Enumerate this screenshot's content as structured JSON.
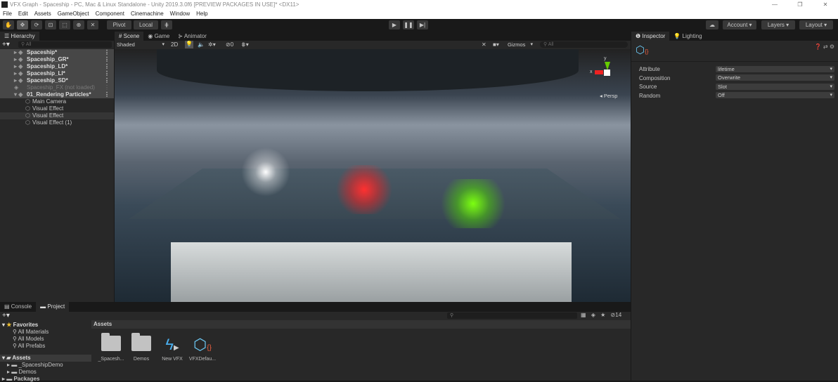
{
  "window": {
    "title": "VFX Graph - Spaceship - PC, Mac & Linux Standalone - Unity 2019.3.0f6 [PREVIEW PACKAGES IN USE]* <DX11>",
    "controls": [
      "—",
      "❐",
      "✕"
    ]
  },
  "menu": [
    "File",
    "Edit",
    "Assets",
    "GameObject",
    "Component",
    "Cinemachine",
    "Window",
    "Help"
  ],
  "toolbar": {
    "pivot": "Pivot",
    "local": "Local",
    "account": "Account",
    "layers": "Layers",
    "layout": "Layout"
  },
  "hierarchy": {
    "tab": "Hierarchy",
    "search_placeholder": "All",
    "items": [
      {
        "label": "Spaceship*",
        "type": "scene"
      },
      {
        "label": "Spaceship_GR*",
        "type": "scene"
      },
      {
        "label": "Spaceship_LD*",
        "type": "scene"
      },
      {
        "label": "Spaceship_LI*",
        "type": "scene"
      },
      {
        "label": "Spaceship_SD*",
        "type": "scene"
      },
      {
        "label": "Spaceship_FX (not loaded)",
        "type": "unloaded"
      },
      {
        "label": "01_Rendering Particles*",
        "type": "scene"
      },
      {
        "label": "Main Camera",
        "type": "object"
      },
      {
        "label": "Visual Effect",
        "type": "object"
      },
      {
        "label": "Visual Effect",
        "type": "object"
      },
      {
        "label": "Visual Effect (1)",
        "type": "object"
      }
    ]
  },
  "scene": {
    "tabs": [
      "Scene",
      "Game",
      "Animator"
    ],
    "shading": "Shaded",
    "mode_2d": "2D",
    "hidden_count": "0",
    "gizmos": "Gizmos",
    "search_placeholder": "All",
    "projection": "Persp",
    "axis_x": "x",
    "axis_y": "y"
  },
  "inspector": {
    "tabs": [
      "Inspector",
      "Lighting"
    ],
    "fields": [
      {
        "label": "Attribute",
        "value": "lifetime"
      },
      {
        "label": "Composition",
        "value": "Overwrite"
      },
      {
        "label": "Source",
        "value": "Slot"
      },
      {
        "label": "Random",
        "value": "Off"
      }
    ]
  },
  "bottom": {
    "tabs": [
      "Console",
      "Project"
    ],
    "hidden_count": "14",
    "tree": {
      "favorites": "Favorites",
      "fav_items": [
        "All Materials",
        "All Models",
        "All Prefabs"
      ],
      "assets": "Assets",
      "asset_children": [
        "_SpaceshipDemo",
        "Demos"
      ],
      "packages": "Packages"
    },
    "breadcrumb": "Assets",
    "assets": [
      "_Spacesh...",
      "Demos",
      "New VFX",
      "VFXDefau..."
    ]
  }
}
